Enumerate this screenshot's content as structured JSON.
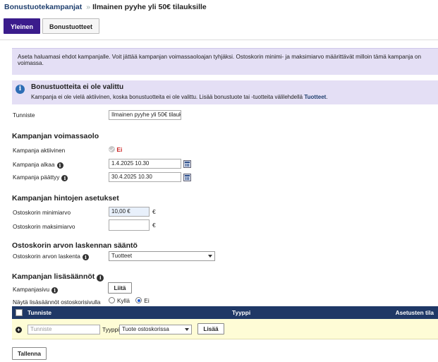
{
  "breadcrumb": {
    "parent": "Bonustuotekampanjat",
    "current": "Ilmainen pyyhe yli 50€ tilauksille"
  },
  "tabs": [
    {
      "label": "Yleinen",
      "active": true
    },
    {
      "label": "Bonustuotteet",
      "active": false
    }
  ],
  "info_text": "Aseta haluamasi ehdot kampanjalle. Voit jättää kampanjan voimassaoloajan tyhjäksi. Ostoskorin minimi- ja maksimiarvo määrittävät milloin tämä kampanja on voimassa.",
  "notice": {
    "title": "Bonustuotteita ei ole valittu",
    "text": "Kampanja ei ole vielä aktiivinen, koska bonustuotteita ei ole valittu. Lisää bonustuote tai -tuotteita välilehdellä ",
    "link": "Tuotteet",
    "suffix": "."
  },
  "identifier": {
    "label": "Tunniste",
    "value": "Ilmainen pyyhe yli 50€ tilauksille"
  },
  "validity": {
    "heading": "Kampanjan voimassaolo",
    "active_label": "Kampanja aktiivinen",
    "active_value": "Ei",
    "start_label": "Kampanja alkaa",
    "start_value": "1.4.2025 10.30",
    "end_label": "Kampanja päättyy",
    "end_value": "30.4.2025 10.30"
  },
  "pricing": {
    "heading": "Kampanjan hintojen asetukset",
    "min_label": "Ostoskorin minimiarvo",
    "min_value": "10,00 €",
    "max_label": "Ostoskorin maksimiarvo",
    "max_value": "",
    "currency": "€"
  },
  "calc": {
    "heading": "Ostoskorin arvon laskennan sääntö",
    "label": "Ostoskorin arvon laskenta",
    "value": "Tuotteet"
  },
  "rules": {
    "heading": "Kampanjan lisäsäännöt",
    "page_label": "Kampanjasivu",
    "attach_button": "Liitä",
    "show_label": "Näytä lisäsäännöt ostoskorisivulla",
    "yes": "Kyllä",
    "no": "Ei",
    "columns": [
      "Tunniste",
      "Tyyppi",
      "Asetusten tila"
    ],
    "new_row": {
      "placeholder": "Tunniste",
      "type_label": "Tyyppi:",
      "type_value": "Tuote ostoskorissa",
      "add_button": "Lisää"
    }
  },
  "save_button": "Tallenna",
  "colors": {
    "primary": "#3b1c8c",
    "header": "#1f3866",
    "info_bg": "#e4dff5",
    "row_bg": "#fefcd6",
    "status_no": "#cc2222"
  }
}
